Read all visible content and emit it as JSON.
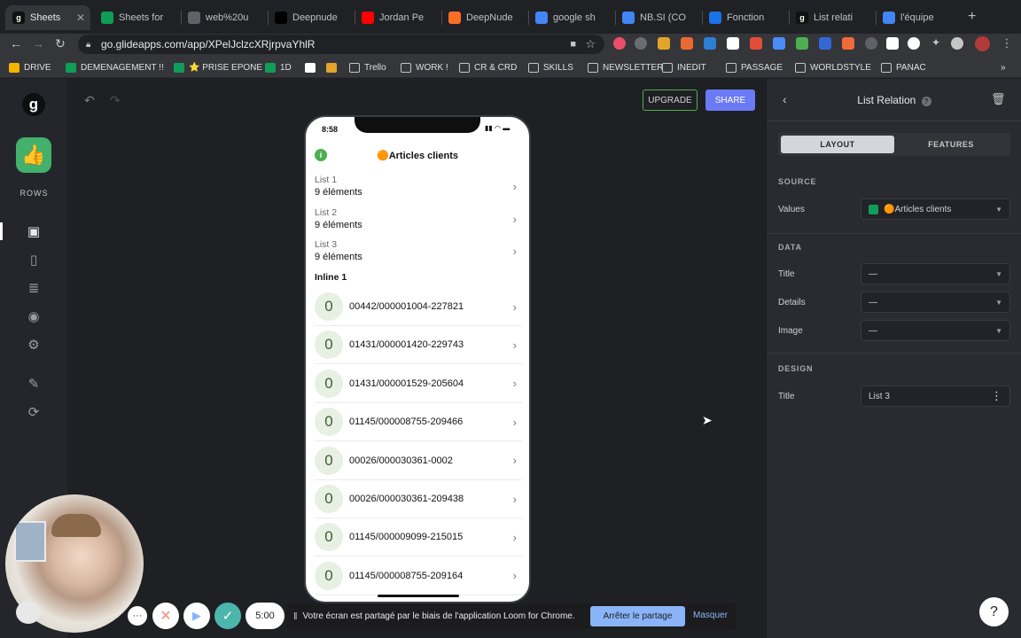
{
  "browser": {
    "tabs": [
      {
        "label": "Sheets",
        "icon": "glide-icon",
        "color": "#111111",
        "active": true
      },
      {
        "label": "Sheets for",
        "icon": "sheets-icon",
        "color": "#0f9d58"
      },
      {
        "label": "web%20u",
        "icon": "globe-icon",
        "color": "#5f6368"
      },
      {
        "label": "Deepnude",
        "icon": "site-icon",
        "color": "#000000"
      },
      {
        "label": "Jordan Pe",
        "icon": "youtube-icon",
        "color": "#ff0000"
      },
      {
        "label": "DeepNude",
        "icon": "gitlab-icon",
        "color": "#fc6d26"
      },
      {
        "label": "google sh",
        "icon": "google-icon",
        "color": "#4285f4"
      },
      {
        "label": "NB.SI (CO",
        "icon": "google-icon",
        "color": "#4285f4"
      },
      {
        "label": "Fonction",
        "icon": "docs-icon",
        "color": "#1a73e8"
      },
      {
        "label": "List relati",
        "icon": "glide-icon",
        "color": "#111111"
      },
      {
        "label": "l'équipe",
        "icon": "google-icon",
        "color": "#4285f4"
      }
    ],
    "url": "go.glideapps.com/app/XPelJclzcXRjrpvaYhlR",
    "bookmarks": [
      {
        "label": "DRIVE",
        "icon": "drive-icon"
      },
      {
        "label": "DEMENAGEMENT !!",
        "icon": "sheets-icon"
      },
      {
        "label": "⭐ PRISE EPONE",
        "icon": "sheets-icon"
      },
      {
        "label": "1D",
        "icon": "sheets-icon"
      },
      {
        "label": "",
        "icon": "notion-icon"
      },
      {
        "label": "",
        "icon": "app-icon"
      },
      {
        "label": "Trello",
        "icon": "folder-icon"
      },
      {
        "label": "WORK !",
        "icon": "folder-icon"
      },
      {
        "label": "CR & CRD",
        "icon": "folder-icon"
      },
      {
        "label": "SKILLS",
        "icon": "folder-icon"
      },
      {
        "label": "NEWSLETTER",
        "icon": "folder-icon"
      },
      {
        "label": "INEDIT",
        "icon": "folder-icon"
      },
      {
        "label": "PASSAGE",
        "icon": "folder-icon"
      },
      {
        "label": "WORLDSTYLE",
        "icon": "folder-icon"
      },
      {
        "label": "PANAC",
        "icon": "folder-icon"
      }
    ]
  },
  "rail": {
    "logo": "g",
    "section_label": "ROWS"
  },
  "canvas": {
    "upgrade_label": "UPGRADE",
    "share_label": "SHARE"
  },
  "phone": {
    "time": "8:58",
    "title": "🟠Articles clients",
    "lists": [
      {
        "title": "List 1",
        "sub": "9 éléments"
      },
      {
        "title": "List 2",
        "sub": "9 éléments"
      },
      {
        "title": "List 3",
        "sub": "9 éléments"
      }
    ],
    "inline_title": "Inline 1",
    "rows": [
      {
        "badge": "0",
        "text": "00442/000001004-227821"
      },
      {
        "badge": "0",
        "text": "01431/000001420-229743"
      },
      {
        "badge": "0",
        "text": "01431/000001529-205604"
      },
      {
        "badge": "0",
        "text": "01145/000008755-209466"
      },
      {
        "badge": "0",
        "text": "00026/000030361-0002"
      },
      {
        "badge": "0",
        "text": "00026/000030361-209438"
      },
      {
        "badge": "0",
        "text": "01145/000009099-215015"
      },
      {
        "badge": "0",
        "text": "01145/000008755-209164"
      }
    ]
  },
  "panel": {
    "title": "List Relation",
    "tabs": [
      "LAYOUT",
      "FEATURES"
    ],
    "source_section": "SOURCE",
    "values_label": "Values",
    "values_value": "🟠Articles clients",
    "data_section": "DATA",
    "title_label": "Title",
    "title_value": "—",
    "details_label": "Details",
    "details_value": "—",
    "image_label": "Image",
    "image_value": "—",
    "design_section": "DESIGN",
    "design_title_label": "Title",
    "design_title_value": "List 3"
  },
  "loom": {
    "timer": "5:00",
    "message": "Votre écran est partagé par le biais de l'application Loom for Chrome.",
    "stop_label": "Arrêter le partage",
    "hide_label": "Masquer"
  },
  "help_label": "?",
  "colors": {
    "accent": "#6b7bf5",
    "upgrade_border": "#4caf50",
    "loom_stop": "#8ab4f8",
    "loom_check": "#4db6ac"
  }
}
